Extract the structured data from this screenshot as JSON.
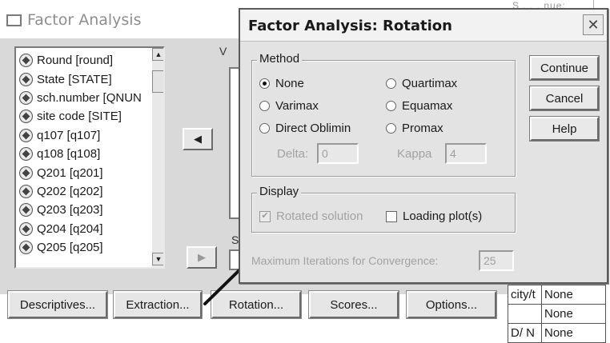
{
  "main": {
    "title": "Factor Analysis",
    "top_scribble": "S . . . nue:",
    "v_fragment": "V",
    "s_fragment": "S",
    "variables": [
      "Round [round]",
      "State [STATE]",
      "sch.number [QNUN",
      "site code [SITE]",
      "q107 [q107]",
      "q108 [q108]",
      "Q201 [q201]",
      "Q202 [q202]",
      "Q203 [q203]",
      "Q204 [q204]",
      "Q205 [q205]"
    ],
    "move_left_glyph": "◀",
    "move_right_glyph": "▶",
    "buttons": {
      "descriptives": "Descriptives...",
      "extraction": "Extraction...",
      "rotation": "Rotation...",
      "scores": "Scores...",
      "options": "Options..."
    }
  },
  "side_table": [
    [
      "city/t",
      "None"
    ],
    [
      "",
      "None"
    ],
    [
      "D/ N",
      "None"
    ]
  ],
  "dialog": {
    "title": "Factor Analysis: Rotation",
    "close_glyph": "✕",
    "method": {
      "legend": "Method",
      "options": {
        "none": "None",
        "varimax": "Varimax",
        "direct_oblimin": "Direct Oblimin",
        "quartimax": "Quartimax",
        "equamax": "Equamax",
        "promax": "Promax"
      },
      "selected": "None",
      "delta_label": "Delta:",
      "delta_value": "0",
      "kappa_label": "Kappa",
      "kappa_value": "4"
    },
    "display": {
      "legend": "Display",
      "rotated_solution": "Rotated solution",
      "rotated_solution_checked": true,
      "loading_plots": "Loading plot(s)",
      "loading_plots_checked": false
    },
    "max_iter_label": "Maximum Iterations for Convergence:",
    "max_iter_value": "25",
    "buttons": {
      "continue": "Continue",
      "cancel": "Cancel",
      "help": "Help"
    }
  }
}
